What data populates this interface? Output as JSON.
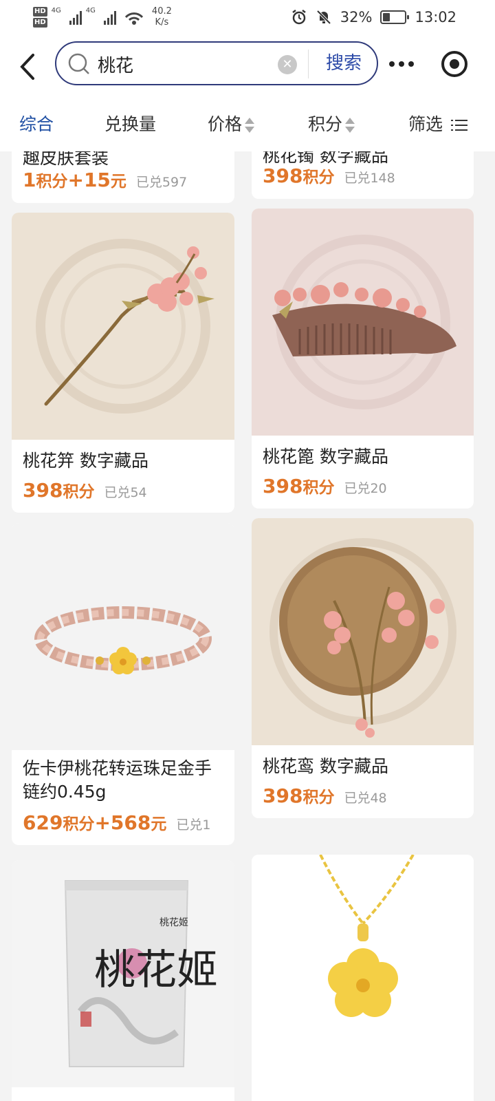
{
  "status_bar": {
    "hd1": "HD",
    "hd1_idx": "1",
    "hd2": "HD",
    "hd2_idx": "2",
    "net1": "4G",
    "net2": "4G",
    "speed": "40.2",
    "speed_unit": "K/s",
    "battery": "32%",
    "battery_level": 0.32,
    "time": "13:02"
  },
  "header": {
    "search_value": "桃花",
    "search_button": "搜索"
  },
  "tabs": [
    {
      "label": "综合",
      "active": true
    },
    {
      "label": "兑换量",
      "active": false
    },
    {
      "label": "价格",
      "active": false
    },
    {
      "label": "积分",
      "active": false
    },
    {
      "label": "筛选",
      "active": false
    }
  ],
  "colors": {
    "accent": "#1f4fa3",
    "price": "#e0762a",
    "search_border": "#2f3a7a"
  },
  "products": [
    {
      "title": "趣皮肤套装",
      "price_main": "1",
      "price_unit": "积分",
      "price_extra": "+15",
      "price_extra_unit": "元",
      "sold": "已兑597"
    },
    {
      "title": "桃花镯 数字藏品",
      "price_main": "398",
      "price_unit": "积分",
      "sold": "已兑148"
    },
    {
      "title": "桃花笄 数字藏品",
      "price_main": "398",
      "price_unit": "积分",
      "sold": "已兑54"
    },
    {
      "title": "桃花篦 数字藏品",
      "price_main": "398",
      "price_unit": "积分",
      "sold": "已兑20"
    },
    {
      "title": "佐卡伊桃花转运珠足金手链约0.45g",
      "price_main": "629",
      "price_unit": "积分",
      "price_extra": "+568",
      "price_extra_unit": "元",
      "sold": "已兑1"
    },
    {
      "title": "桃花鸾 数字藏品",
      "price_main": "398",
      "price_unit": "积分",
      "sold": "已兑48"
    },
    {
      "package_brand": "桃花姬",
      "package_side": "桃花姬"
    },
    {
      "image_note": ""
    }
  ]
}
